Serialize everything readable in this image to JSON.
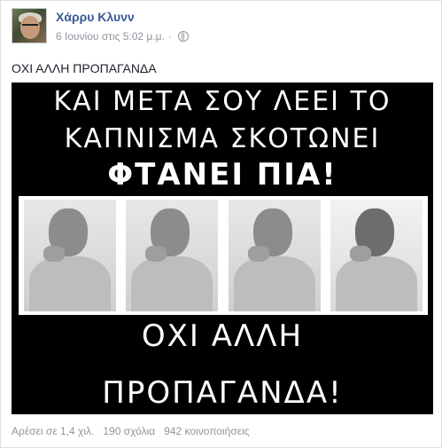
{
  "post": {
    "author": "Χάρρυ Κλυνν",
    "timestamp": "6 Ιουνίου στις 5:02 μ.μ.",
    "separator": "·",
    "privacy_icon": "globe-icon",
    "text": "ΟΧΙ ΑΛΛΗ ΠΡΟΠΑΓΑΝΔΑ"
  },
  "image": {
    "line1": "ΚΑΙ ΜΕΤΑ ΣΟΥ ΛΕΕΙ ΤΟ",
    "line2": "ΚΑΠΝΙΣΜΑ ΣΚΟΤΩΝΕΙ",
    "line3": "ΦΤΑΝΕΙ ΠΙΑ!",
    "line4": "ΟΧΙ ΑΛΛΗ",
    "line5": "ΠΡΟΠΑΓΑΝΔΑ!"
  },
  "stats": {
    "likes": "Αρέσει σε 1,4 χιλ.",
    "comments": "190 σχόλια",
    "shares": "942 κοινοποιήσεις"
  },
  "colors": {
    "author_link": "#3b5998",
    "meta_text": "#90949c",
    "image_bg": "#000000"
  }
}
